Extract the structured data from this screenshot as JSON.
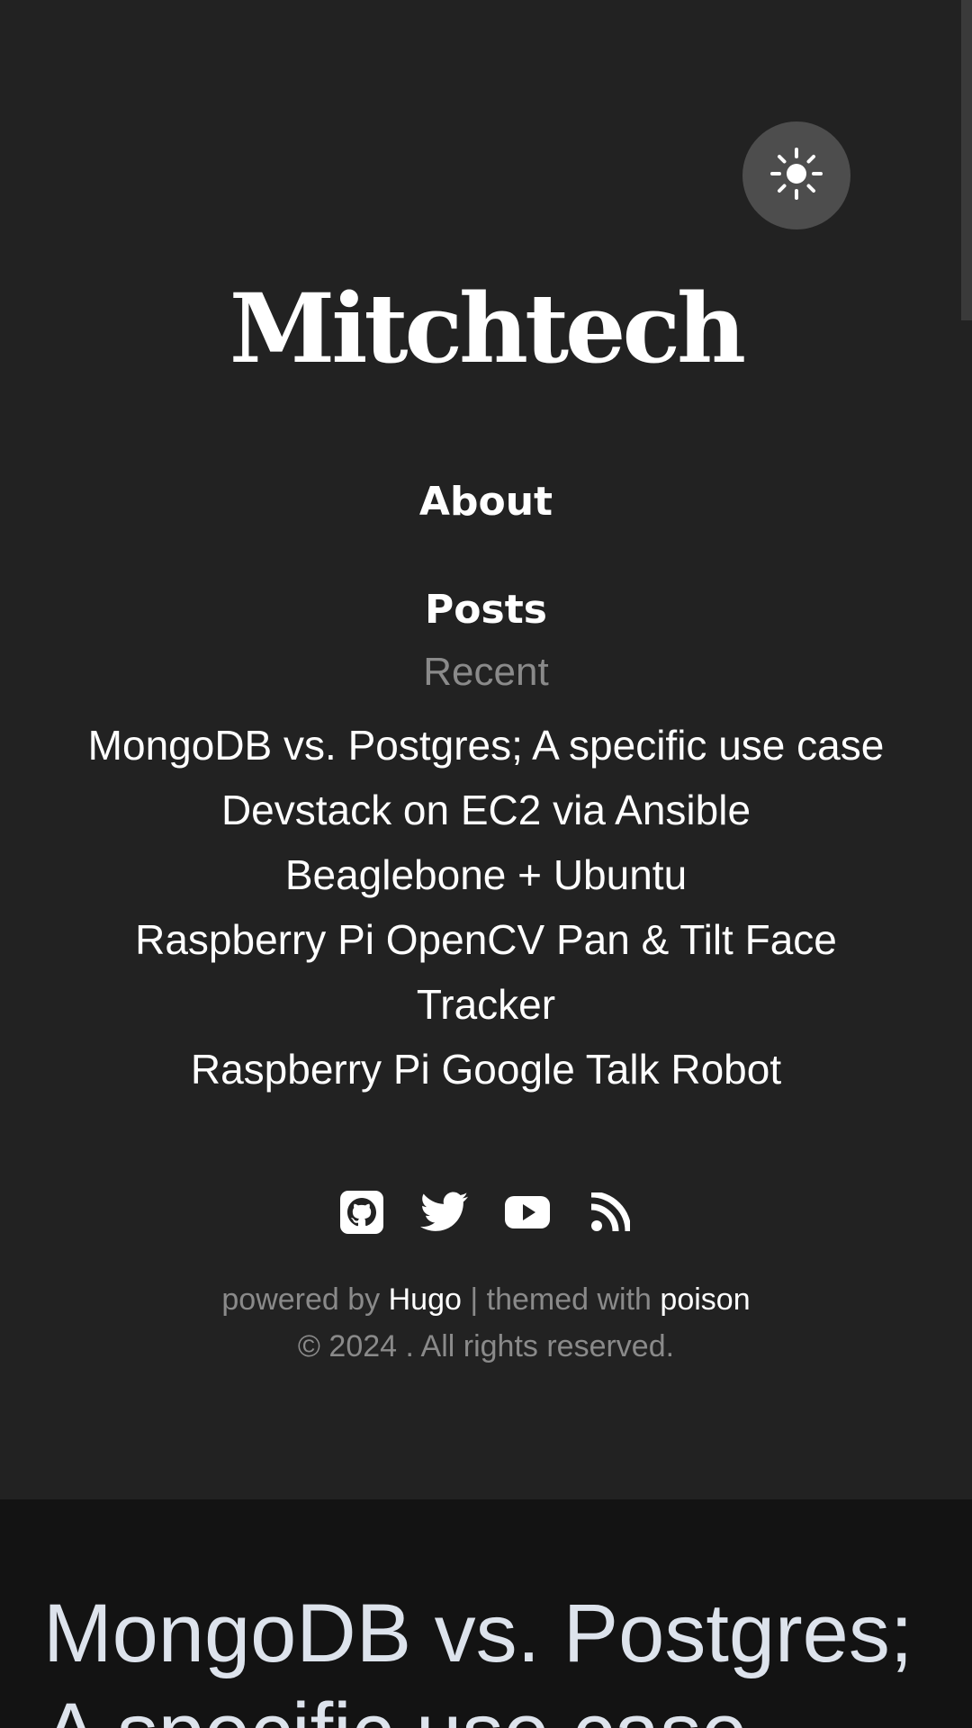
{
  "site": {
    "title": "Mitchtech"
  },
  "theme_toggle": {
    "icon": "sun-icon"
  },
  "nav": {
    "about": "About",
    "posts": "Posts"
  },
  "recent": {
    "label": "Recent",
    "items": [
      "MongoDB vs. Postgres; A specific use case",
      "Devstack on EC2 via Ansible",
      "Beaglebone + Ubuntu",
      "Raspberry Pi OpenCV Pan & Tilt Face Tracker",
      "Raspberry Pi Google Talk Robot"
    ]
  },
  "social": [
    "github-icon",
    "twitter-icon",
    "youtube-icon",
    "rss-icon"
  ],
  "footer": {
    "powered_by": "powered by ",
    "hugo": "Hugo",
    "separator": " | themed with ",
    "poison": "poison",
    "copyright": "© 2024 . All rights reserved."
  },
  "main": {
    "title": "MongoDB vs. Postgres; A specific use case"
  },
  "colors": {
    "sidebar_bg": "#222222",
    "page_bg": "#131313",
    "muted_text": "#8a8a8a",
    "title_text": "#dde3ec"
  }
}
